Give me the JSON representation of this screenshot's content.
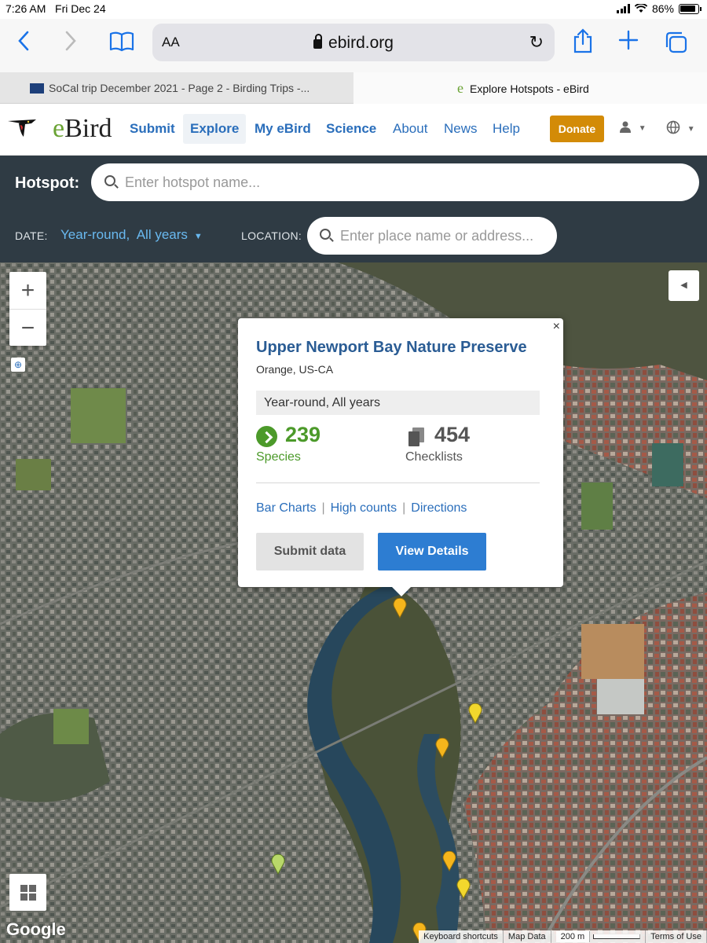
{
  "status_bar": {
    "time": "7:26 AM",
    "date": "Fri Dec 24",
    "battery": "86%"
  },
  "browser": {
    "text_size_label": "AA",
    "url": "ebird.org",
    "tabs": [
      {
        "title": "SoCal trip December 2021 - Page 2 - Birding Trips -..."
      },
      {
        "title": "Explore Hotspots - eBird"
      }
    ]
  },
  "site": {
    "logo_text_e": "e",
    "logo_text_rest": "Bird",
    "nav": [
      "Submit",
      "Explore",
      "My eBird",
      "Science",
      "About",
      "News",
      "Help"
    ],
    "donate_label": "Donate"
  },
  "search": {
    "hotspot_label": "Hotspot:",
    "hotspot_placeholder": "Enter hotspot name...",
    "date_label": "DATE:",
    "date_value": "Year-round,  All years",
    "location_label": "LOCATION:",
    "location_placeholder": "Enter place name or address..."
  },
  "map": {
    "zoom_in": "+",
    "zoom_out": "−",
    "google_label": "Google",
    "attribution": [
      "Keyboard shortcuts",
      "Map Data",
      "200 m",
      "Terms of Use"
    ],
    "marker_colors": {
      "orange": "#f5b51c",
      "yellow": "#f2d72d",
      "green": "#b9d86a"
    }
  },
  "popup": {
    "close": "×",
    "title": "Upper Newport Bay Nature Preserve",
    "region": "Orange, US-CA",
    "range": "Year-round, All years",
    "species_count": "239",
    "species_label": "Species",
    "checklists_count": "454",
    "checklists_label": "Checklists",
    "links": [
      "Bar Charts",
      "High counts",
      "Directions"
    ],
    "submit_label": "Submit data",
    "view_label": "View Details",
    "colors": {
      "title": "#2a5c94",
      "species": "#4c9a2a",
      "view_button": "#2d7dd2"
    }
  }
}
